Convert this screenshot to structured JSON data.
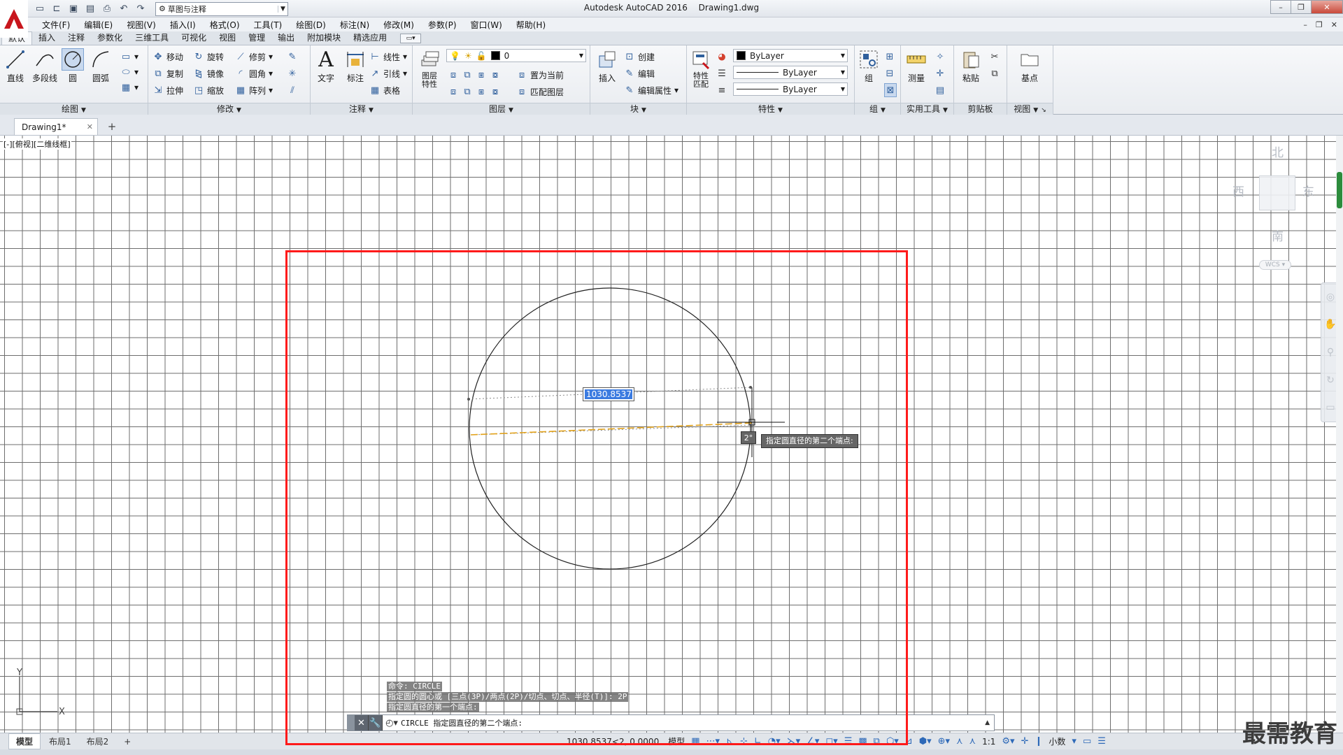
{
  "window": {
    "title": "Autodesk AutoCAD 2016",
    "document": "Drawing1.dwg",
    "workspace": "草图与注释"
  },
  "menubar": [
    "文件(F)",
    "编辑(E)",
    "视图(V)",
    "插入(I)",
    "格式(O)",
    "工具(T)",
    "绘图(D)",
    "标注(N)",
    "修改(M)",
    "参数(P)",
    "窗口(W)",
    "帮助(H)"
  ],
  "ribbon_tabs": [
    "默认",
    "插入",
    "注释",
    "参数化",
    "三维工具",
    "可视化",
    "视图",
    "管理",
    "输出",
    "附加模块",
    "精选应用"
  ],
  "ribbon": {
    "draw": {
      "title": "绘图",
      "line": "直线",
      "polyline": "多段线",
      "circle": "圆",
      "arc": "圆弧"
    },
    "modify": {
      "title": "修改",
      "move": "移动",
      "rotate": "旋转",
      "trim": "修剪",
      "copy": "复制",
      "mirror": "镜像",
      "fillet": "圆角",
      "stretch": "拉伸",
      "scale": "缩放",
      "array": "阵列"
    },
    "annotation": {
      "title": "注释",
      "text": "文字",
      "dimension": "标注",
      "linear": "线性",
      "leader": "引线",
      "table": "表格"
    },
    "layers": {
      "title": "图层",
      "properties": "图层\n特性",
      "current_layer": "0",
      "set_current": "置为当前",
      "match_layer": "匹配图层"
    },
    "block": {
      "title": "块",
      "insert": "插入",
      "create": "创建",
      "edit": "编辑",
      "edit_attributes": "编辑属性"
    },
    "properties": {
      "title": "特性",
      "match": "特性\n匹配",
      "color": "ByLayer",
      "linetype": "ByLayer",
      "lineweight": "ByLayer"
    },
    "groups": {
      "title": "组",
      "group": "组"
    },
    "utilities": {
      "title": "实用工具",
      "measure": "测量"
    },
    "clipboard": {
      "title": "剪贴板",
      "paste": "粘贴"
    },
    "view": {
      "title": "视图",
      "base": "基点"
    }
  },
  "file_tab": "Drawing1*",
  "viewport_label": "[-][俯视][二维线框]",
  "viewcube": {
    "north": "北",
    "south": "南",
    "east": "东",
    "west": "西",
    "wcs": "WCS"
  },
  "dynamic_input": {
    "value": "1030.8537",
    "angle": "2°",
    "prompt": "指定圆直径的第二个端点:"
  },
  "command_history": [
    "命令: CIRCLE",
    "指定圆的圆心或 [三点(3P)/两点(2P)/切点、切点、半径(T)]: 2P",
    "指定圆直径的第一个端点:"
  ],
  "command_line": "CIRCLE 指定圆直径的第二个端点:",
  "layout_tabs": [
    "模型",
    "布局1",
    "布局2"
  ],
  "status": {
    "coords": "1030.8537<2, 0.0000",
    "mode": "模型",
    "scale": "1:1",
    "units": "小数"
  },
  "watermark": "最需教育",
  "colors": {
    "accent": "#3b7be0",
    "highlight": "#ff1a1a",
    "autocad_red": "#c8161d"
  }
}
